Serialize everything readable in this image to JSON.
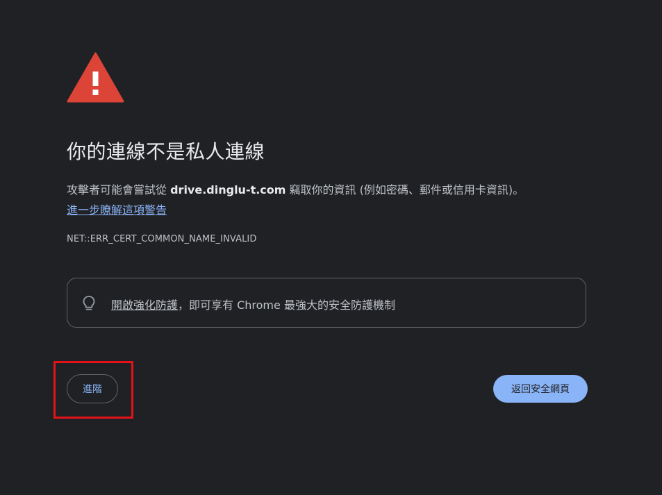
{
  "icons": {
    "warning": "warning-triangle-icon",
    "bulb": "lightbulb-icon"
  },
  "colors": {
    "background": "#202124",
    "warning_red": "#db4437",
    "link_blue": "#8ab4f8",
    "highlight_red": "#e3121b"
  },
  "page": {
    "title": "你的連線不是私人連線",
    "explanation_prefix": "攻擊者可能會嘗試從 ",
    "domain": "drive.dinglu-t.com",
    "explanation_suffix": " 竊取你的資訊 (例如密碼、郵件或信用卡資訊)。",
    "learn_more": "進一步瞭解這項警告",
    "error_code": "NET::ERR_CERT_COMMON_NAME_INVALID"
  },
  "enhanced_protection": {
    "link_text": "開啟強化防護",
    "rest_text": "，即可享有 Chrome 最強大的安全防護機制"
  },
  "buttons": {
    "advanced": "進階",
    "back_to_safety": "返回安全網頁"
  }
}
